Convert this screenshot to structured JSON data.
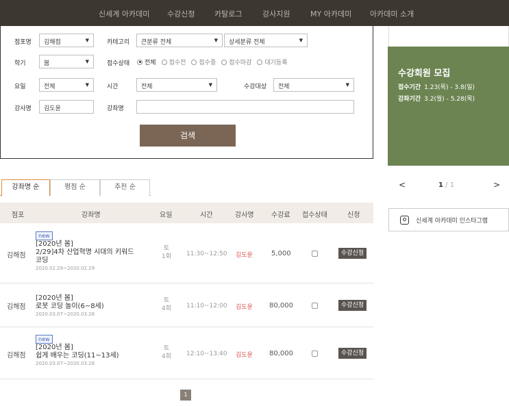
{
  "nav": {
    "items": [
      "신세계 아카데미",
      "수강신청",
      "카탈로그",
      "강사지원",
      "MY 아카데미",
      "아카데미 소개"
    ]
  },
  "search": {
    "branch_label": "점포명",
    "branch_value": "김해점",
    "category_label": "카테고리",
    "category_main": "큰분류 전체",
    "category_sub": "상세분류 전체",
    "term_label": "학기",
    "term_value": "봄",
    "status_label": "접수상태",
    "status_options": [
      "전체",
      "접수전",
      "접수중",
      "접수마감",
      "대기등록"
    ],
    "status_selected": "전체",
    "day_label": "요일",
    "day_value": "전체",
    "time_label": "시간",
    "time_value": "전체",
    "target_label": "수강대상",
    "target_value": "전체",
    "instructor_label": "강사명",
    "instructor_value": "김도윤",
    "course_label": "강좌명",
    "course_value": "",
    "search_button": "검색"
  },
  "promo": {
    "title": "수강회원 모집",
    "reg_label": "접수기간",
    "reg_period": "1.23(목) - 3.8(일)",
    "course_label": "강좌기간",
    "course_period": "3.2(월) - 5.28(목)",
    "bg_color": "#6c8452"
  },
  "pager": {
    "prev": "<",
    "current": "1",
    "separator": "/",
    "total": "1",
    "next": ">"
  },
  "instagram": {
    "label": "신세계 아카데미 인스타그램",
    "icon": "instagram-icon"
  },
  "tabs": [
    "강좌명 순",
    "평점 순",
    "추천 순"
  ],
  "table": {
    "headers": [
      "점포",
      "강좌명",
      "요일",
      "시간",
      "강사명",
      "수강료",
      "접수상태",
      "신청"
    ],
    "rows": [
      {
        "branch": "김해점",
        "is_new": true,
        "badge": "new",
        "term": "[2020년 봄]",
        "title": "2/29]4차 산업혁명 시대의 키워드",
        "title2": "코딩",
        "dates": "2020.02.29~2020.02.29",
        "day": "토",
        "sessions": "1회",
        "time": "11:30~12:50",
        "instructor": "김도윤",
        "fee": "5,000",
        "apply": "수강신청"
      },
      {
        "branch": "김해점",
        "is_new": false,
        "badge": "",
        "term": "[2020년 봄]",
        "title": "로봇 코딩 놀이(6~8세)",
        "title2": "",
        "dates": "2020.03.07~2020.03.28",
        "day": "토",
        "sessions": "4회",
        "time": "11:10~12:00",
        "instructor": "김도윤",
        "fee": "80,000",
        "apply": "수강신청"
      },
      {
        "branch": "김해점",
        "is_new": true,
        "badge": "new",
        "term": "[2020년 봄]",
        "title": "쉽게 배우는 코딩(11~13세)",
        "title2": "",
        "dates": "2020.03.07~2020.03.28",
        "day": "토",
        "sessions": "4회",
        "time": "12:10~13:40",
        "instructor": "김도윤",
        "fee": "80,000",
        "apply": "수강신청"
      }
    ]
  },
  "pagination": {
    "page": "1"
  },
  "colors": {
    "nav_bg": "#3c3731",
    "accent": "#d98b3a",
    "button": "#7b6656",
    "instructor": "#d9534f"
  }
}
